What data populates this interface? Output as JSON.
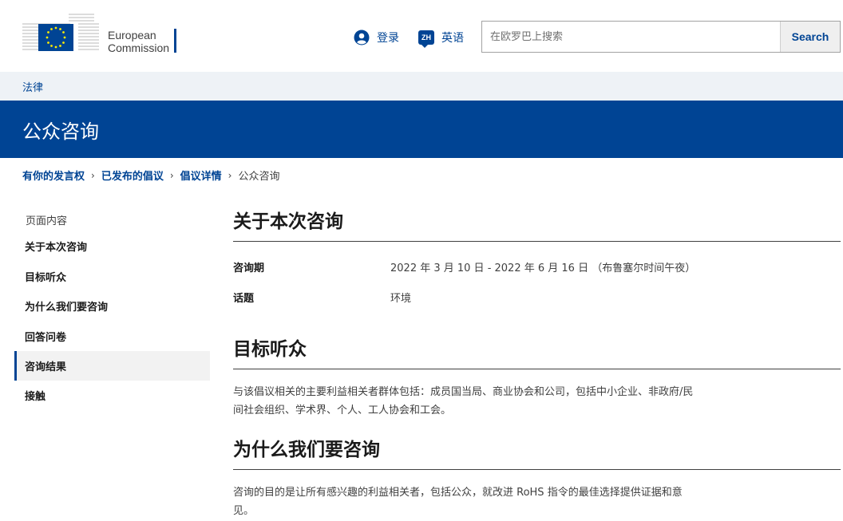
{
  "header": {
    "logo_line1": "European",
    "logo_line2": "Commission",
    "login_label": "登录",
    "lang_code": "ZH",
    "lang_label": "英语",
    "search_placeholder": "在欧罗巴上搜索",
    "search_button": "Search"
  },
  "site_name": "法律",
  "page_title": "公众咨询",
  "breadcrumb": {
    "items": [
      "有你的发言权",
      "已发布的倡议",
      "倡议详情"
    ],
    "current": "公众咨询"
  },
  "sidebar": {
    "title": "页面内容",
    "items": [
      "关于本次咨询",
      "目标听众",
      "为什么我们要咨询",
      "回答问卷",
      "咨询结果",
      "接触"
    ],
    "active_index": 4
  },
  "sections": {
    "about": {
      "title": "关于本次咨询",
      "period_label": "咨询期",
      "period_value": "2022 年 3 月 10 日 - 2022 年 6 月 16 日 （布鲁塞尔时间午夜）",
      "topic_label": "话题",
      "topic_value": "环境"
    },
    "audience": {
      "title": "目标听众",
      "line1": "与该倡议相关的主要利益相关者群体包括：成员国当局、商业协会和公司，包括中小企业、非政府/民",
      "line2": "间社会组织、学术界、个人、工人协会和工会。"
    },
    "why": {
      "title": "为什么我们要咨询",
      "line1": "咨询的目的是让所有感兴趣的利益相关者，包括公众，就改进 RoHS 指令的最佳选择提供证据和意",
      "line2": "见。"
    }
  },
  "colors": {
    "brand": "#004494",
    "strip": "#eef2f6"
  }
}
